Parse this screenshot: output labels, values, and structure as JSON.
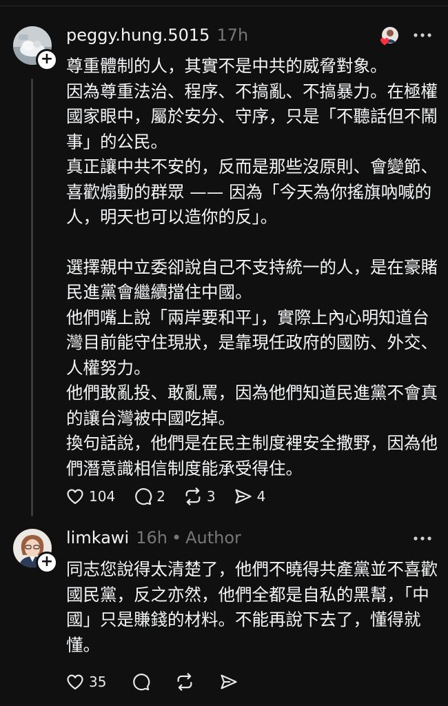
{
  "post1": {
    "username": "peggy.hung.5015",
    "time": "17h",
    "paragraphs": [
      "尊重體制的人，其實不是中共的威脅對象。",
      "因為尊重法治、程序、不搞亂、不搞暴力。在極權國家眼中，屬於安分、守序，只是「不聽話但不鬧事」的公民。",
      "真正讓中共不安的，反而是那些沒原則、會變節、喜歡煽動的群眾 —— 因為「今天為你搖旗吶喊的人，明天也可以造你的反」。",
      "",
      "選擇親中立委卻說自己不支持統一的人，是在豪賭民進黨會繼續擋住中國。",
      "他們嘴上說「兩岸要和平」，實際上內心明知道台灣目前能守住現狀，是靠現任政府的國防、外交、人權努力。",
      "他們敢亂投、敢亂罵，因為他們知道民進黨不會真的讓台灣被中國吃掉。",
      "換句話說，他們是在民主制度裡安全撒野，因為他們潛意識相信制度能承受得住。"
    ],
    "likes": "104",
    "replies": "2",
    "reposts": "3",
    "shares": "4"
  },
  "post2": {
    "username": "limkawi",
    "time": "16h",
    "separator": "•",
    "author_label": "Author",
    "paragraphs": [
      "同志您說得太清楚了，他們不曉得共產黨並不喜歡國民黨，反之亦然，他們全都是自私的黑幫，「中國」只是賺錢的材料。不能再說下去了，懂得就懂。"
    ],
    "likes": "35"
  },
  "icons": {
    "like": "heart-icon",
    "reply": "comment-icon",
    "repost": "repost-icon",
    "share": "send-icon",
    "more": "more-dots-icon",
    "follow": "plus-icon"
  },
  "colors": {
    "background": "#101010",
    "text": "#f3f5f7",
    "muted": "#777777",
    "heart": "#ff3040"
  }
}
